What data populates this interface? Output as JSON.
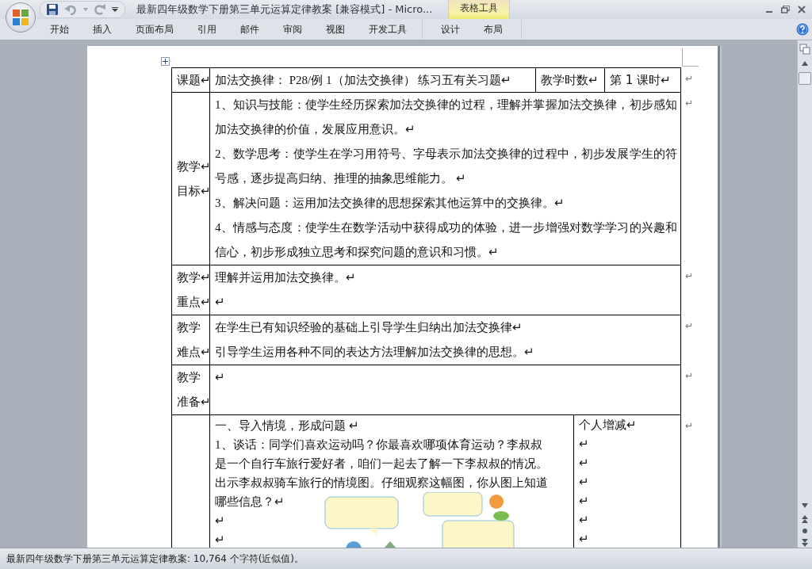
{
  "window": {
    "title": "最新四年级数学下册第三单元运算定律教案 [兼容模式] - Micro...",
    "context_group": "表格工具"
  },
  "ribbon_tabs": [
    {
      "label": "开始"
    },
    {
      "label": "插入"
    },
    {
      "label": "页面布局"
    },
    {
      "label": "引用"
    },
    {
      "label": "邮件"
    },
    {
      "label": "审阅"
    },
    {
      "label": "视图"
    },
    {
      "label": "开发工具"
    }
  ],
  "context_tabs": [
    {
      "label": "设计"
    },
    {
      "label": "布局"
    }
  ],
  "document": {
    "rows": [
      {
        "kind": "header",
        "cells": [
          "课题↵",
          "加法交换律：  P28/例 1（加法交换律）  练习五有关习题↵",
          "教学时数↵",
          "第 1 课时↵"
        ],
        "end_mark": "↵"
      },
      {
        "kind": "section",
        "label": [
          "教学↵",
          "目标↵"
        ],
        "paragraphs": [
          "1、知识与技能：使学生经历探索加法交换律的过程，理解并掌握加法交换律，初步感知加法交换律的价值，发展应用意识。↵",
          "2、数学思考：使学生在学习用符号、字母表示加法交换律的过程中，初步发展学生的符号感，逐步提高归纳、推理的抽象思维能力。 ↵",
          "3、解决问题：运用加法交换律的思想探索其他运算中的交换律。↵",
          "4、情感与态度：使学生在数学活动中获得成功的体验，进一步增强对数学学习的兴趣和信心，初步形成独立思考和探究问题的意识和习惯。↵"
        ],
        "end_mark": "↵"
      },
      {
        "kind": "section",
        "label": [
          "教学↵",
          "重点↵"
        ],
        "paragraphs": [
          "理解并运用加法交换律。↵",
          "↵"
        ],
        "end_mark": "↵"
      },
      {
        "kind": "section",
        "label": [
          "教学",
          "难点↵"
        ],
        "paragraphs": [
          "在学生已有知识经验的基础上引导学生归纳出加法交换律↵",
          "引导学生运用各种不同的表达方法理解加法交换律的思想。↵"
        ],
        "end_mark": "↵"
      },
      {
        "kind": "section",
        "label": [
          "教学",
          "准备↵"
        ],
        "paragraphs": [
          "↵"
        ],
        "end_mark": "↵"
      },
      {
        "kind": "lesson",
        "paragraphs": [
          "一、导入情境，形成问题 ↵",
          "1、谈话：同学们喜欢运动吗？你最喜欢哪项体育运动？李叔叔是一个自行车旅行爱好者，咱们一起去了解一下李叔叔的情况。出示李叔叔骑车旅行的情境图。仔细观察这幅图，你从图上知道哪些信息？↵"
        ],
        "after_picture": [
          "↵",
          "↵"
        ],
        "side": [
          "个人增减↵",
          "↵",
          "↵",
          "↵",
          "↵",
          "↵",
          "↵"
        ],
        "end_mark": "↵"
      }
    ]
  },
  "status_bar": {
    "text": "最新四年级数学下册第三单元运算定律教案: 10,764 个字符(近似值)。"
  }
}
